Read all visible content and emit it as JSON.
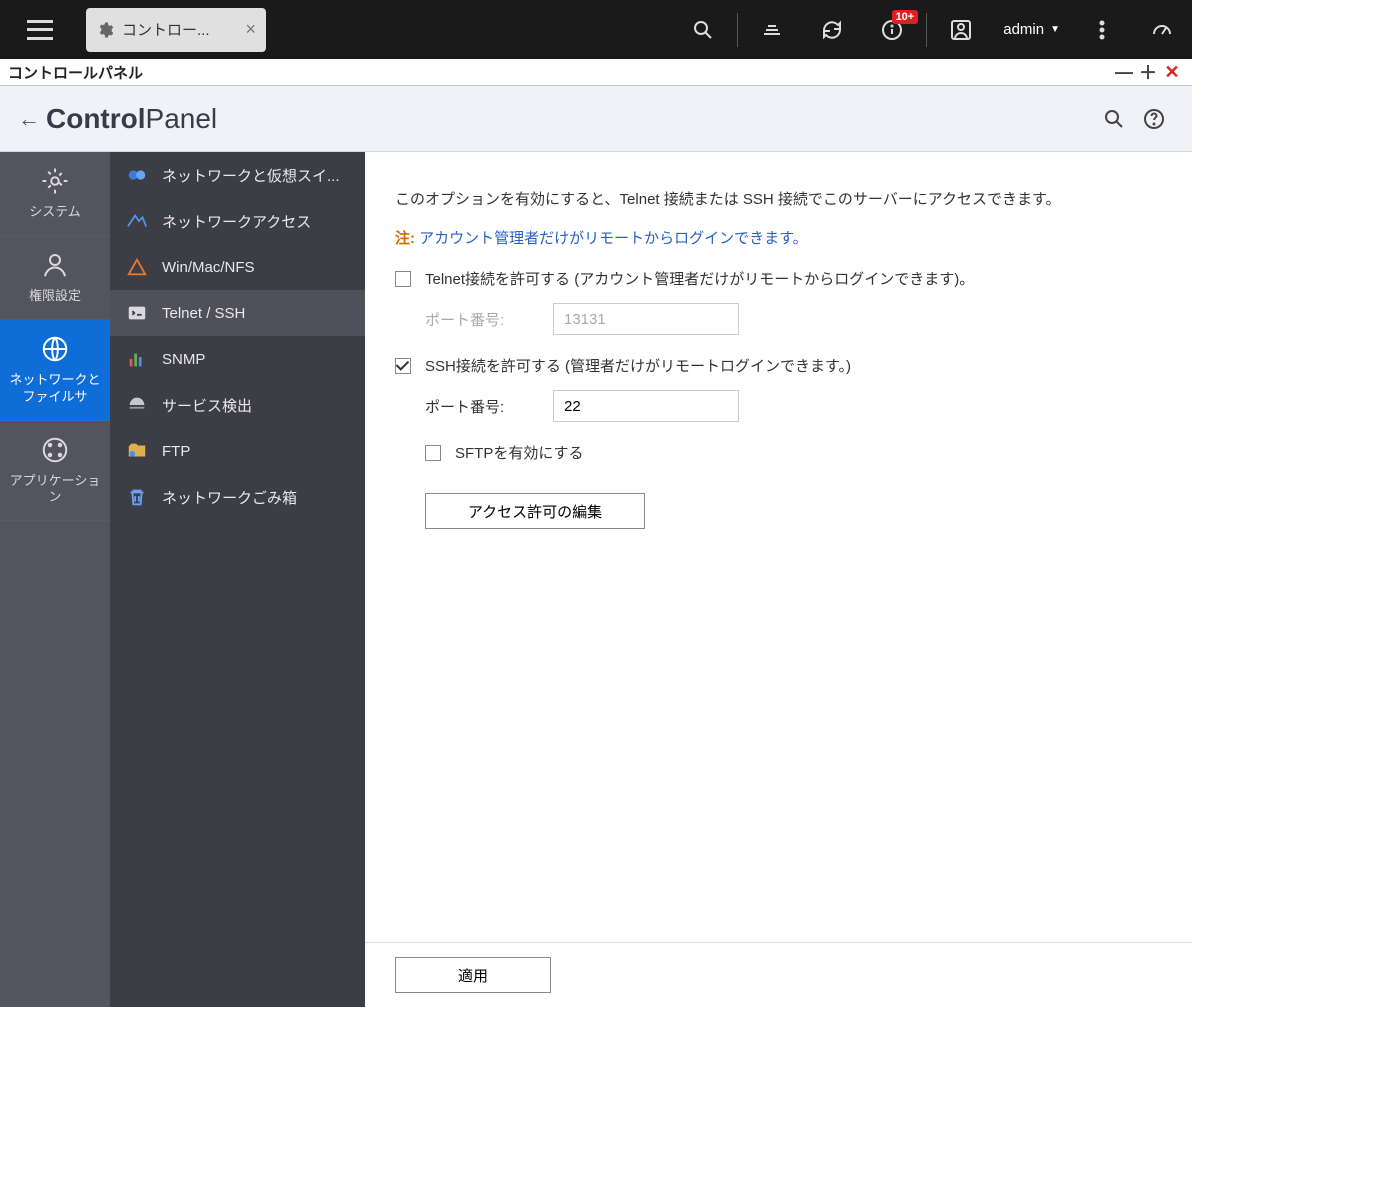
{
  "topbar": {
    "tab_title": "コントロー...",
    "notif_badge": "10+",
    "user_label": "admin"
  },
  "window": {
    "title": "コントロールパネル"
  },
  "header": {
    "title_bold": "Control",
    "title_light": "Panel"
  },
  "pnav": [
    {
      "label": "システム"
    },
    {
      "label": "権限設定"
    },
    {
      "label": "ネットワークとファイルサ"
    },
    {
      "label": "アプリケーション"
    }
  ],
  "snav": [
    {
      "label": "ネットワークと仮想スイ..."
    },
    {
      "label": "ネットワークアクセス"
    },
    {
      "label": "Win/Mac/NFS"
    },
    {
      "label": "Telnet / SSH"
    },
    {
      "label": "SNMP"
    },
    {
      "label": "サービス検出"
    },
    {
      "label": "FTP"
    },
    {
      "label": "ネットワークごみ箱"
    }
  ],
  "content": {
    "description": "このオプションを有効にすると、Telnet 接続または SSH 接続でこのサーバーにアクセスできます。",
    "note_label": "注:",
    "note_text": " アカウント管理者だけがリモートからログインできます。",
    "telnet_label": "Telnet接続を許可する (アカウント管理者だけがリモートからログインできます)。",
    "port_label": "ポート番号:",
    "telnet_port_value": "13131",
    "ssh_label": "SSH接続を許可する (管理者だけがリモートログインできます。)",
    "ssh_port_value": "22",
    "sftp_label": "SFTPを有効にする",
    "edit_perm_label": "アクセス許可の編集",
    "apply_label": "適用"
  }
}
